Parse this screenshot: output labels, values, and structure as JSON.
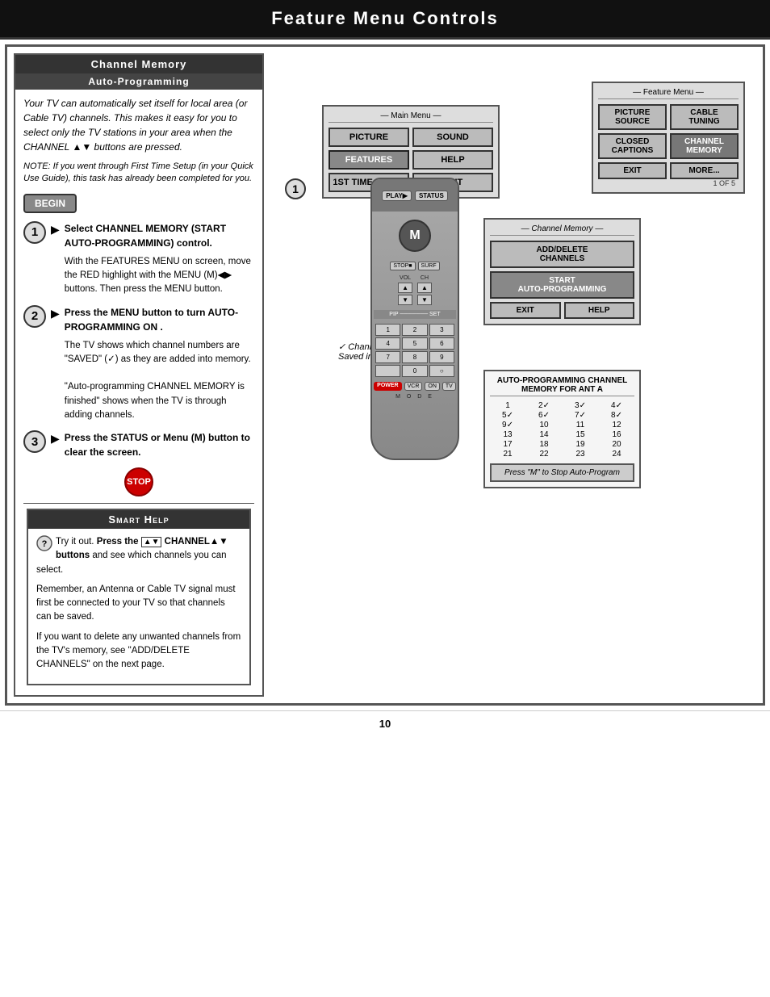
{
  "header": {
    "title": "Feature Menu Controls"
  },
  "left_panel": {
    "section_title": "Channel Memory",
    "section_subtitle": "Auto-Programming",
    "intro_text": "Your TV can automatically set itself for local area (or Cable TV) channels. This makes it easy for you to select only the TV stations in your area when the CHANNEL ▲▼ buttons are pressed.",
    "note_text": "NOTE: If you went through First Time Setup (in your Quick Use Guide), this task has already been completed for you.",
    "begin_label": "BEGIN",
    "steps": [
      {
        "num": "1",
        "title": "Select CHANNEL MEMORY (START AUTO-PROGRAMMING) control.",
        "detail": "With the FEATURES MENU on screen, move the RED highlight with the MENU (M)◀▶ buttons. Then press the MENU button."
      },
      {
        "num": "2",
        "title": "Press the MENU button to turn AUTO-PROGRAMMING ON .",
        "detail": "The TV shows which channel numbers are \"SAVED\" (✓) as they are added into memory.\n\"Auto-programming CHANNEL MEMORY is finished\" shows when the TV is through adding channels."
      },
      {
        "num": "3",
        "title": "Press the STATUS or Menu (M) button to clear the screen.",
        "detail": ""
      }
    ],
    "stop_label": "STOP"
  },
  "smart_help": {
    "title": "Smart Help",
    "paragraphs": [
      "Try it out. Press the CHANNEL▲▼ buttons and see which channels you can select.",
      "Remember, an Antenna or Cable TV signal must first be connected to your TV so that channels can be saved.",
      "If you want to delete any unwanted channels from the TV's memory, see \"ADD/DELETE CHANNELS\" on the next page."
    ]
  },
  "main_menu": {
    "label": "— Main Menu —",
    "buttons": [
      {
        "label": "PICTURE",
        "highlighted": false
      },
      {
        "label": "SOUND",
        "highlighted": false
      },
      {
        "label": "FEATURES",
        "highlighted": true
      },
      {
        "label": "HELP",
        "highlighted": false
      },
      {
        "label": "1ST TIME SETUP",
        "highlighted": false
      },
      {
        "label": "EXIT",
        "highlighted": false
      }
    ]
  },
  "feature_menu": {
    "label": "— Feature Menu —",
    "buttons": [
      {
        "label": "PICTURE SOURCE",
        "highlighted": false
      },
      {
        "label": "CABLE TUNING",
        "highlighted": false
      },
      {
        "label": "CLOSED CAPTIONS",
        "highlighted": false
      },
      {
        "label": "CHANNEL MEMORY",
        "highlighted": true
      },
      {
        "label": "EXIT",
        "highlighted": false
      },
      {
        "label": "MORE...",
        "highlighted": false
      }
    ],
    "count": "1 OF 5"
  },
  "channel_memory_menu": {
    "label": "— Channel Memory —",
    "buttons": [
      {
        "label": "ADD/DELETE CHANNELS",
        "highlighted": false
      },
      {
        "label": "START AUTO-PROGRAMMING",
        "highlighted": true
      },
      {
        "label": "EXIT",
        "highlighted": false
      },
      {
        "label": "HELP",
        "highlighted": false
      }
    ]
  },
  "auto_prog": {
    "title": "AUTO-PROGRAMMING CHANNEL MEMORY FOR ANT A",
    "channels": [
      {
        "num": "1",
        "saved": false
      },
      {
        "num": "2",
        "saved": true
      },
      {
        "num": "3",
        "saved": true
      },
      {
        "num": "4",
        "saved": true
      },
      {
        "num": "5",
        "saved": true
      },
      {
        "num": "6",
        "saved": true
      },
      {
        "num": "7",
        "saved": true
      },
      {
        "num": "8",
        "saved": true
      },
      {
        "num": "9",
        "saved": true
      },
      {
        "num": "10",
        "saved": false
      },
      {
        "num": "11",
        "saved": false
      },
      {
        "num": "12",
        "saved": false
      },
      {
        "num": "13",
        "saved": false
      },
      {
        "num": "14",
        "saved": false
      },
      {
        "num": "15",
        "saved": false
      },
      {
        "num": "16",
        "saved": false
      },
      {
        "num": "17",
        "saved": false
      },
      {
        "num": "18",
        "saved": false
      },
      {
        "num": "19",
        "saved": false
      },
      {
        "num": "20",
        "saved": false
      },
      {
        "num": "21",
        "saved": false
      },
      {
        "num": "22",
        "saved": false
      },
      {
        "num": "23",
        "saved": false
      },
      {
        "num": "24",
        "saved": false
      }
    ],
    "press_m_note": "Press \"M\" to Stop Auto-Program"
  },
  "channel_note": "✓ Channel Numbers are\nSaved in Memory",
  "page_number": "10"
}
